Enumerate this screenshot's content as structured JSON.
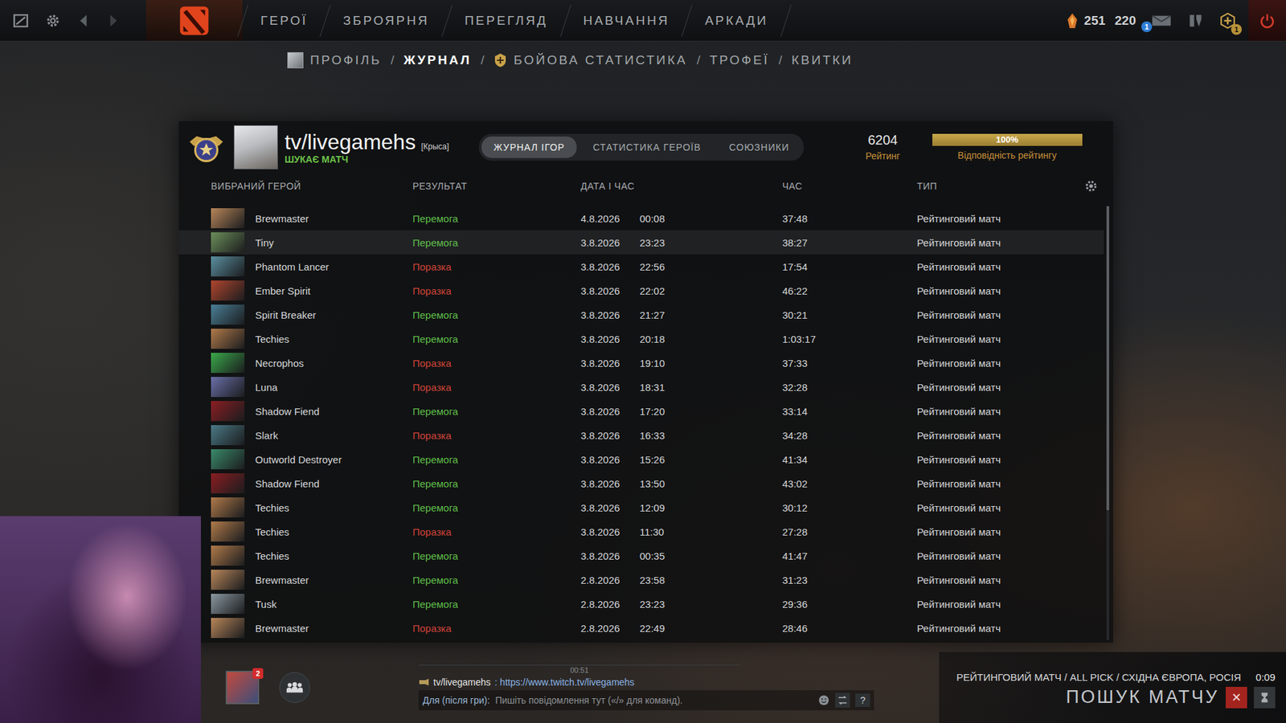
{
  "top_nav": {
    "items": [
      {
        "label": "ГЕРОЇ"
      },
      {
        "label": "ЗБРОЯРНЯ"
      },
      {
        "label": "ПЕРЕГЛЯД"
      },
      {
        "label": "НАВЧАННЯ"
      },
      {
        "label": "АРКАДИ"
      }
    ],
    "shards": "251",
    "currency": "220",
    "mail_badge": "1",
    "plus_badge": "1"
  },
  "sub_nav": {
    "separator": "/",
    "items": [
      {
        "label": "ПРОФІЛЬ",
        "selected": false
      },
      {
        "label": "ЖУРНАЛ",
        "selected": true
      },
      {
        "label": "БОЙОВА СТАТИСТИКА",
        "selected": false
      },
      {
        "label": "ТРОФЕЇ",
        "selected": false
      },
      {
        "label": "КВИТКИ",
        "selected": false
      }
    ]
  },
  "profile": {
    "name": "tv/livegamehs",
    "tag": "[Крыса]",
    "status": "ШУКАЄ МАТЧ"
  },
  "tabs": [
    {
      "label": "ЖУРНАЛ ІГОР",
      "selected": true
    },
    {
      "label": "СТАТИСТИКА ГЕРОЇВ",
      "selected": false
    },
    {
      "label": "СОЮЗНИКИ",
      "selected": false
    }
  ],
  "rating": {
    "value": "6204",
    "label": "Рейтинг",
    "confidence_reading": "100%",
    "confidence_level": 1,
    "confidence_label": "Відповідність рейтингу"
  },
  "table": {
    "columns": [
      "ВИБРАНИЙ ГЕРОЙ",
      "РЕЗУЛЬТАТ",
      "ДАТА І ЧАС",
      "ЧАС",
      "ТИП"
    ],
    "rows": [
      {
        "hero": "Brewmaster",
        "result": "Перемога",
        "win": true,
        "date": "4.8.2026",
        "time": "00:08",
        "duration": "37:48",
        "type": "Рейтинговий матч",
        "selected": false,
        "color": "#b8865a"
      },
      {
        "hero": "Tiny",
        "result": "Перемога",
        "win": true,
        "date": "3.8.2026",
        "time": "23:23",
        "duration": "38:27",
        "type": "Рейтинговий матч",
        "selected": true,
        "color": "#6b8f5a"
      },
      {
        "hero": "Phantom Lancer",
        "result": "Поразка",
        "win": false,
        "date": "3.8.2026",
        "time": "22:56",
        "duration": "17:54",
        "type": "Рейтинговий матч",
        "selected": false,
        "color": "#5a8fa0"
      },
      {
        "hero": "Ember Spirit",
        "result": "Поразка",
        "win": false,
        "date": "3.8.2026",
        "time": "22:02",
        "duration": "46:22",
        "type": "Рейтинговий матч",
        "selected": false,
        "color": "#b0452e"
      },
      {
        "hero": "Spirit Breaker",
        "result": "Перемога",
        "win": true,
        "date": "3.8.2026",
        "time": "21:27",
        "duration": "30:21",
        "type": "Рейтинговий матч",
        "selected": false,
        "color": "#4a7f96"
      },
      {
        "hero": "Techies",
        "result": "Перемога",
        "win": true,
        "date": "3.8.2026",
        "time": "20:18",
        "duration": "1:03:17",
        "type": "Рейтинговий матч",
        "selected": false,
        "color": "#b07a4a"
      },
      {
        "hero": "Necrophos",
        "result": "Поразка",
        "win": false,
        "date": "3.8.2026",
        "time": "19:10",
        "duration": "37:33",
        "type": "Рейтинговий матч",
        "selected": false,
        "color": "#3aa84a"
      },
      {
        "hero": "Luna",
        "result": "Поразка",
        "win": false,
        "date": "3.8.2026",
        "time": "18:31",
        "duration": "32:28",
        "type": "Рейтинговий матч",
        "selected": false,
        "color": "#6a6fa8"
      },
      {
        "hero": "Shadow Fiend",
        "result": "Перемога",
        "win": true,
        "date": "3.8.2026",
        "time": "17:20",
        "duration": "33:14",
        "type": "Рейтинговий матч",
        "selected": false,
        "color": "#8a1e22"
      },
      {
        "hero": "Slark",
        "result": "Поразка",
        "win": false,
        "date": "3.8.2026",
        "time": "16:33",
        "duration": "34:28",
        "type": "Рейтинговий матч",
        "selected": false,
        "color": "#4a7a86"
      },
      {
        "hero": "Outworld Destroyer",
        "result": "Перемога",
        "win": true,
        "date": "3.8.2026",
        "time": "15:26",
        "duration": "41:34",
        "type": "Рейтинговий матч",
        "selected": false,
        "color": "#3a8a6a"
      },
      {
        "hero": "Shadow Fiend",
        "result": "Перемога",
        "win": true,
        "date": "3.8.2026",
        "time": "13:50",
        "duration": "43:02",
        "type": "Рейтинговий матч",
        "selected": false,
        "color": "#8a1e22"
      },
      {
        "hero": "Techies",
        "result": "Перемога",
        "win": true,
        "date": "3.8.2026",
        "time": "12:09",
        "duration": "30:12",
        "type": "Рейтинговий матч",
        "selected": false,
        "color": "#b07a4a"
      },
      {
        "hero": "Techies",
        "result": "Поразка",
        "win": false,
        "date": "3.8.2026",
        "time": "11:30",
        "duration": "27:28",
        "type": "Рейтинговий матч",
        "selected": false,
        "color": "#b07a4a"
      },
      {
        "hero": "Techies",
        "result": "Перемога",
        "win": true,
        "date": "3.8.2026",
        "time": "00:35",
        "duration": "41:47",
        "type": "Рейтинговий матч",
        "selected": false,
        "color": "#b07a4a"
      },
      {
        "hero": "Brewmaster",
        "result": "Перемога",
        "win": true,
        "date": "2.8.2026",
        "time": "23:58",
        "duration": "31:23",
        "type": "Рейтинговий матч",
        "selected": false,
        "color": "#b8865a"
      },
      {
        "hero": "Tusk",
        "result": "Перемога",
        "win": true,
        "date": "2.8.2026",
        "time": "23:23",
        "duration": "29:36",
        "type": "Рейтинговий матч",
        "selected": false,
        "color": "#8a98a0"
      },
      {
        "hero": "Brewmaster",
        "result": "Поразка",
        "win": false,
        "date": "2.8.2026",
        "time": "22:49",
        "duration": "28:46",
        "type": "Рейтинговий матч",
        "selected": false,
        "color": "#b8865a"
      }
    ]
  },
  "party": {
    "badge": "2"
  },
  "chat": {
    "time": "00:51",
    "sender": "tv/livegamehs",
    "message": ": https://www.twitch.tv/livegamehs",
    "channel_label": "Для (після гри):",
    "placeholder": "Пишіть повідомлення тут («/» для команд).",
    "help": "?"
  },
  "matchmaking": {
    "mode": "РЕЙТИНГОВИЙ МАТЧ / ALL PICK / СХІДНА ЄВРОПА, РОСІЯ",
    "timer": "0:09",
    "label": "ПОШУК МАТЧУ",
    "cancel": "✕"
  }
}
